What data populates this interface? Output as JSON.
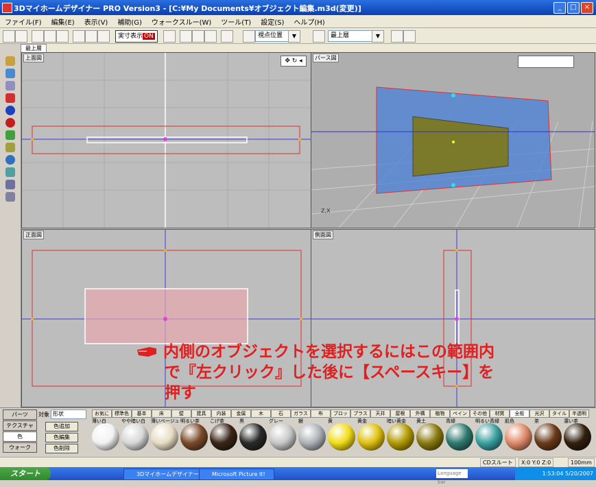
{
  "window": {
    "title": "3Dマイホームデザイナー PRO Version3 - [C:¥My Documents¥オブジェクト編集.m3d(変更)]"
  },
  "menu": [
    "ファイル(F)",
    "編集(E)",
    "表示(V)",
    "補助(G)",
    "ウォークスルー(W)",
    "ツール(T)",
    "設定(S)",
    "ヘルプ(H)"
  ],
  "toolbar": {
    "toggle_label": "実寸表示",
    "toggle_state": "ON",
    "combo_mode": "視点位置",
    "combo_floor": "最上層",
    "dropdown_arrow": "▼"
  },
  "floor_tab": "最上層",
  "viewports": {
    "top": {
      "label": "上面図"
    },
    "perspective": {
      "label": "パース図",
      "axis": "Z,X"
    },
    "front": {
      "label": "正面図"
    },
    "side": {
      "label": "側面図"
    }
  },
  "instruction": {
    "line1": "内側のオブジェクトを選択するにはこの範囲内",
    "line2": "で『左クリック』した後に【スペースキー】を",
    "line3": "押す"
  },
  "panel": {
    "side_buttons": [
      "パーツ",
      "テクスチャ",
      "色",
      "ウォーク"
    ],
    "target_label": "対象",
    "target_value": "形状",
    "mid_buttons": [
      "色追加",
      "色編集",
      "色削除"
    ]
  },
  "material_tabs": [
    "お気に入り",
    "標準色",
    "基本",
    "床",
    "壁",
    "建具",
    "内装",
    "金属",
    "木",
    "石",
    "ガラス",
    "布",
    "ブロック",
    "プラスチック",
    "天井",
    "屋根",
    "外構",
    "植物",
    "ペイント",
    "その他",
    "材質",
    "全般",
    "光沢",
    "タイル",
    "半透明"
  ],
  "materials": [
    {
      "name": "薄い白",
      "color": "#f2f2f2"
    },
    {
      "name": "やや暗い白",
      "color": "#d8d8d8"
    },
    {
      "name": "薄いベージュ",
      "color": "#e8dcc3"
    },
    {
      "name": "明るい茶",
      "color": "#7a4a2a"
    },
    {
      "name": "こげ茶",
      "color": "#3a2518"
    },
    {
      "name": "黒",
      "color": "#2a2a2a"
    },
    {
      "name": "グレー",
      "color": "#c8c8c8"
    },
    {
      "name": "銀",
      "color": "#aeb3b8"
    },
    {
      "name": "黄",
      "color": "#f1dd1a"
    },
    {
      "name": "黄金",
      "color": "#e0c010"
    },
    {
      "name": "暗い黄金",
      "color": "#b29a00"
    },
    {
      "name": "黄土",
      "color": "#8a7a10"
    },
    {
      "name": "青緑",
      "color": "#2e7a70"
    },
    {
      "name": "明るい青緑",
      "color": "#3aa0a0"
    },
    {
      "name": "肌色",
      "color": "#e08a6a"
    },
    {
      "name": "茶",
      "color": "#6a3a1a"
    },
    {
      "name": "濃い茶",
      "color": "#302010"
    }
  ],
  "statusbar": {
    "mode": "CDスルート",
    "coords": "X:0 Y:0 Z:0",
    "size": "100mm"
  },
  "taskbar": {
    "start": "スタート",
    "tasks": [
      "3Dマイホームデザイナー",
      "Microsoft Picture It!"
    ],
    "language_bar": "Language bar",
    "clock": "1:53:04 5/20/2007"
  },
  "colors": {
    "accent_red": "#e02020",
    "xp_blue": "#0a3fb0",
    "viewport_gray": "#bdbdbd"
  }
}
